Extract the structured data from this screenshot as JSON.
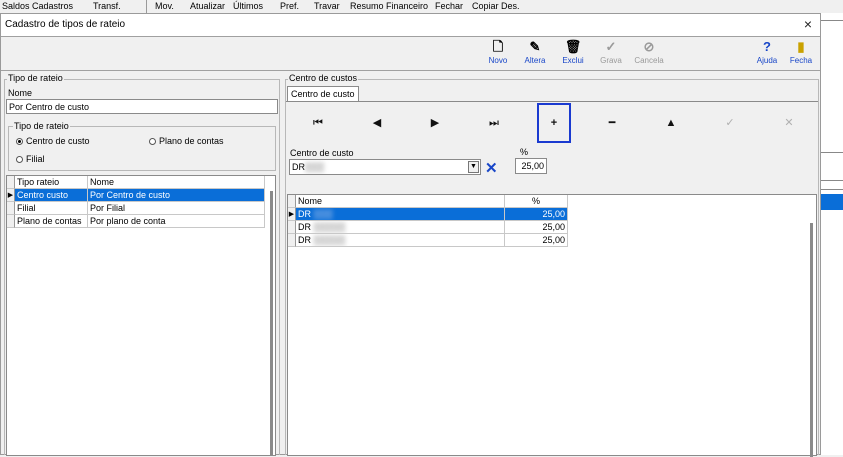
{
  "app_menu": [
    "Saldos",
    "Cadastros",
    "Transf.",
    "Mov.",
    "Atualizar",
    "Últimos",
    "Pref.",
    "Travar",
    "Resumo Financeiro",
    "Fechar",
    "Copiar Des."
  ],
  "dialog": {
    "title": "Cadastro de tipos de rateio",
    "close_glyph": "×"
  },
  "toolbar": {
    "novo": {
      "label": "Novo",
      "icon": "new-document-icon",
      "glyph": "🗋"
    },
    "altera": {
      "label": "Altera",
      "icon": "edit-document-icon",
      "glyph": "✎"
    },
    "exclui": {
      "label": "Exclui",
      "icon": "trash-icon",
      "glyph": "🗑"
    },
    "grava": {
      "label": "Grava",
      "icon": "checkmark-icon",
      "glyph": "✓"
    },
    "cancela": {
      "label": "Cancela",
      "icon": "cancel-icon",
      "glyph": "⊘"
    },
    "ajuda": {
      "label": "Ajuda",
      "icon": "help-icon",
      "glyph": "?"
    },
    "fecha": {
      "label": "Fecha",
      "icon": "exit-door-icon",
      "glyph": "▮"
    }
  },
  "left": {
    "group_label": "Tipo de rateio",
    "nome_label": "Nome",
    "nome_value": "Por Centro de custo",
    "radio_group_label": "Tipo de rateio",
    "radios": [
      {
        "label": "Centro de custo",
        "checked": true
      },
      {
        "label": "Plano de contas",
        "checked": false
      },
      {
        "label": "Filial",
        "checked": false
      }
    ],
    "grid": {
      "columns": [
        "Tipo rateio",
        "Nome"
      ],
      "rows": [
        [
          "Centro custo",
          "Por Centro de custo"
        ],
        [
          "Filial",
          "Por Filial"
        ],
        [
          "Plano de contas",
          "Por plano de conta"
        ]
      ],
      "selected_index": 0
    }
  },
  "right": {
    "group_label": "Centro de custos",
    "tab_label": "Centro de custo",
    "navigator": [
      {
        "name": "nav-first",
        "glyph": "⏮"
      },
      {
        "name": "nav-prior",
        "glyph": "◀"
      },
      {
        "name": "nav-next",
        "glyph": "▶"
      },
      {
        "name": "nav-last",
        "glyph": "⏭"
      },
      {
        "name": "nav-insert",
        "glyph": "+"
      },
      {
        "name": "nav-delete",
        "glyph": "━"
      },
      {
        "name": "nav-edit",
        "glyph": "▲"
      },
      {
        "name": "nav-post",
        "glyph": "✓"
      },
      {
        "name": "nav-cancel",
        "glyph": "✕"
      }
    ],
    "cc_label": "Centro de custo",
    "cc_value": "DR",
    "pct_label": "%",
    "pct_value": "25,00",
    "clear_glyph": "✕",
    "grid": {
      "columns": [
        "Nome",
        "%"
      ],
      "rows": [
        [
          "DR",
          "25,00"
        ],
        [
          "DR",
          "25,00"
        ],
        [
          "DR",
          "25,00"
        ]
      ],
      "selected_index": 0
    }
  }
}
